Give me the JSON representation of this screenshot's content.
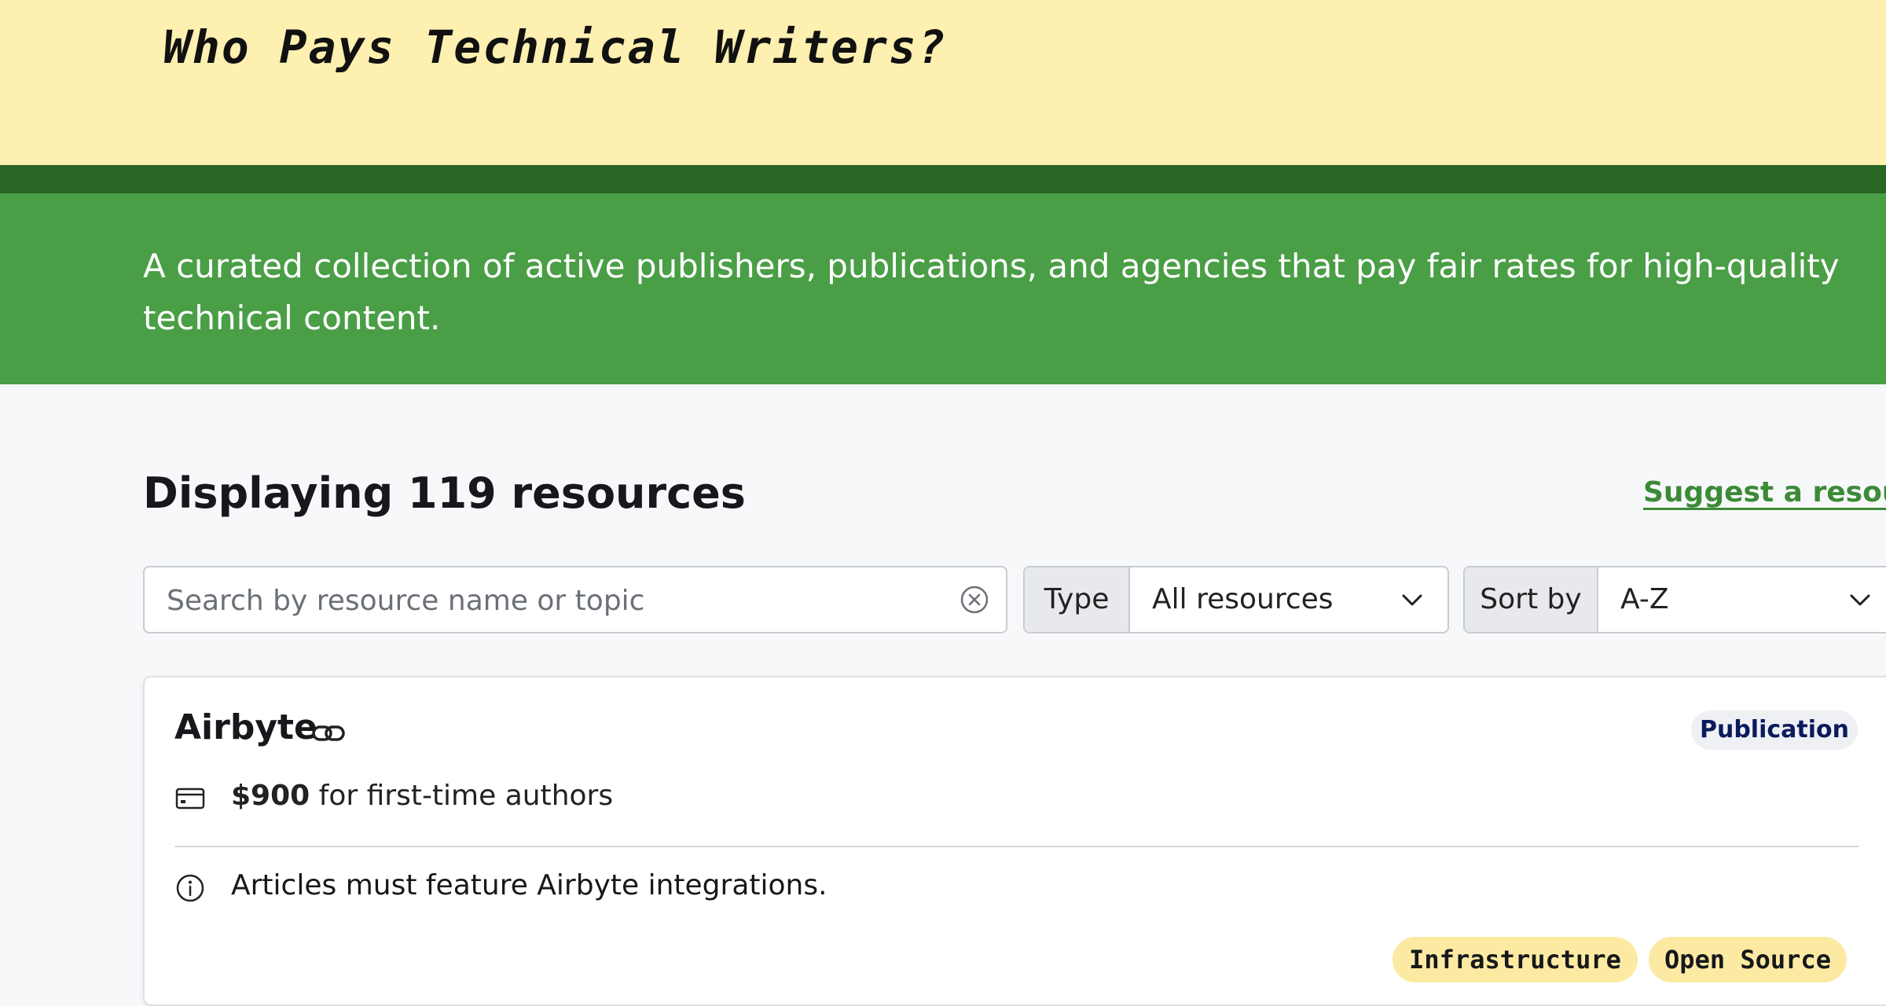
{
  "header": {
    "title": "Who Pays Technical Writers?",
    "tagline": "A curated collection of active publishers, publications, and agencies that pay fair rates for high-quality technical content."
  },
  "results": {
    "heading": "Displaying 119 resources",
    "suggest_link": "Suggest a resource"
  },
  "filters": {
    "search_placeholder": "Search by resource name or topic",
    "search_value": "",
    "type_label": "Type",
    "type_value": "All resources",
    "sort_label": "Sort by",
    "sort_value": "A-Z"
  },
  "resources": [
    {
      "name": "Airbyte",
      "type": "Publication",
      "pay_amount": "$900",
      "pay_note": " for first-time authors",
      "note": "Articles must feature Airbyte integrations.",
      "tags": [
        "Infrastructure",
        "Open Source"
      ]
    }
  ],
  "icons": {
    "clear": "close-circle-icon",
    "chevron": "chevron-down-icon",
    "link": "link-icon",
    "payment": "credit-card-icon",
    "info": "info-icon"
  },
  "colors": {
    "hero_background": "#fef0b0",
    "dark_green": "#2a6626",
    "brand_green": "#4a9e46",
    "link_green": "#3c8a37",
    "tag_background": "#fdeaa2",
    "badge_text": "#0b1a5c"
  }
}
